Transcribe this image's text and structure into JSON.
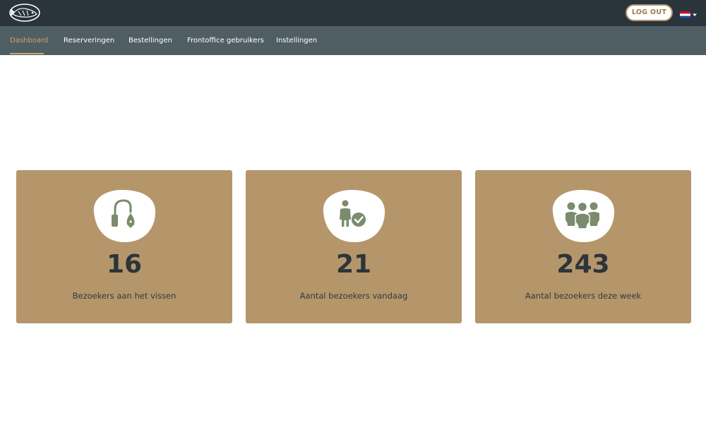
{
  "header": {
    "logout_label": "LOG OUT",
    "language": {
      "icon": "netherlands-flag-icon",
      "caret_icon": "caret-down-icon"
    },
    "logo_icon": "fish-logo-icon"
  },
  "nav": {
    "items": [
      {
        "label": "Dashboard",
        "active": true
      },
      {
        "label": "Reserveringen",
        "active": false
      },
      {
        "label": "Bestellingen",
        "active": false
      },
      {
        "label": "Frontoffice gebruikers",
        "active": false
      },
      {
        "label": "Instellingen",
        "active": false
      }
    ]
  },
  "stats": [
    {
      "value": "16",
      "label": "Bezoekers aan het vissen",
      "icon": "fishing-hook-icon"
    },
    {
      "value": "21",
      "label": "Aantal bezoekers vandaag",
      "icon": "person-check-icon"
    },
    {
      "value": "243",
      "label": "Aantal bezoekers deze week",
      "icon": "group-icon"
    }
  ],
  "colors": {
    "topbar": "#29343b",
    "navbar": "#4f5e63",
    "accent": "#c9a36f",
    "card": "#b5966a",
    "icon": "#7b8b6d",
    "value_text": "#2b353a"
  }
}
